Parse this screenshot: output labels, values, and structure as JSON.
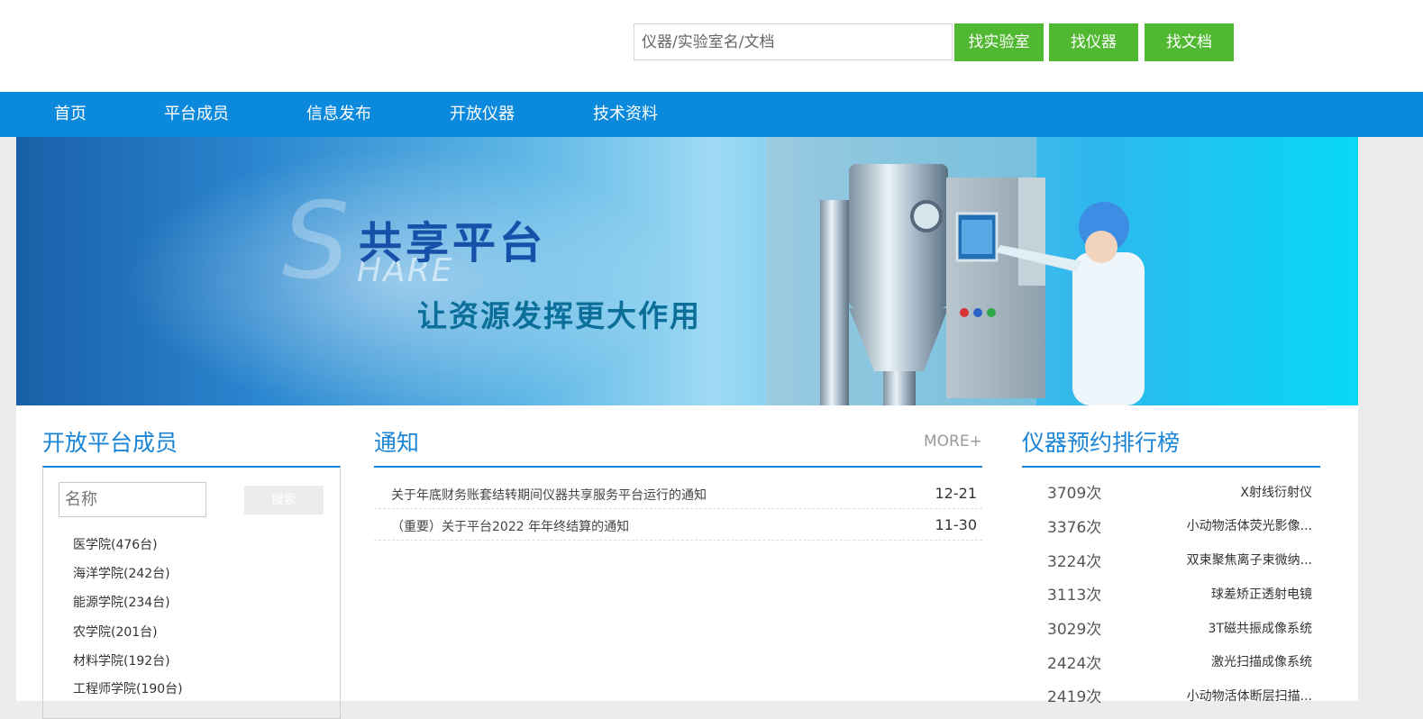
{
  "header": {
    "search_placeholder": "仪器/实验室名/文档",
    "btn_lab": "找实验室",
    "btn_instrument": "找仪器",
    "btn_doc": "找文档"
  },
  "nav": {
    "items": [
      "首页",
      "平台成员",
      "信息发布",
      "开放仪器",
      "技术资料"
    ]
  },
  "banner": {
    "big_letter": "S",
    "hare": "HARE",
    "title": "共享平台",
    "subtitle": "让资源发挥更大作用"
  },
  "members": {
    "title": "开放平台成员",
    "name_placeholder": "名称",
    "search_label": "搜索",
    "items": [
      "医学院(476台)",
      "海洋学院(242台)",
      "能源学院(234台)",
      "农学院(201台)",
      "材料学院(192台)",
      "工程师学院(190台)"
    ]
  },
  "notices": {
    "title": "通知",
    "more": "MORE+",
    "items": [
      {
        "title": "关于年底财务账套结转期间仪器共享服务平台运行的通知",
        "date": "12-21"
      },
      {
        "title": "（重要）关于平台2022 年年终结算的通知",
        "date": "11-30"
      }
    ]
  },
  "ranking": {
    "title": "仪器预约排行榜",
    "items": [
      {
        "count": "3709次",
        "name": "X射线衍射仪"
      },
      {
        "count": "3376次",
        "name": "小动物活体荧光影像..."
      },
      {
        "count": "3224次",
        "name": "双束聚焦离子束微纳..."
      },
      {
        "count": "3113次",
        "name": "球差矫正透射电镜"
      },
      {
        "count": "3029次",
        "name": "3T磁共振成像系统"
      },
      {
        "count": "2424次",
        "name": "激光扫描成像系统"
      },
      {
        "count": "2419次",
        "name": "小动物活体断层扫描..."
      }
    ]
  },
  "colors": {
    "nav": "#0b89dc",
    "button_green": "#51b831",
    "accent_blue": "#1a84d6"
  }
}
